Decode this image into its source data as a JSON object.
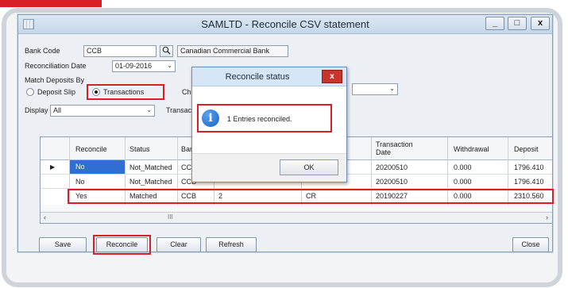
{
  "window": {
    "title": "SAMLTD - Reconcile CSV statement",
    "controls": [
      "_",
      "□",
      "x"
    ]
  },
  "form": {
    "bank_code_label": "Bank Code",
    "bank_code_value": "CCB",
    "bank_name_value": "Canadian Commercial Bank",
    "recon_date_label": "Reconciliation Date",
    "recon_date_value": "01-09-2016",
    "match_label": "Match Deposits By",
    "option_deposit_slip": "Deposit Slip",
    "option_transactions": "Transactions",
    "selected_option": "Transactions",
    "display_label": "Display",
    "display_value": "All",
    "check_label_partial": "Chec",
    "transaction_label_partial": "Transactio"
  },
  "grid": {
    "headers": [
      "Reconcile",
      "Status",
      "Bank",
      "",
      "",
      "Transaction Date",
      "Withdrawal",
      "Deposit"
    ],
    "rows": [
      {
        "reconcile": "No",
        "status": "Not_Matched",
        "bank": "CCB",
        "ref": "",
        "type": "",
        "date": "20200510",
        "withdrawal": "0.000",
        "deposit": "1796.410",
        "current": true
      },
      {
        "reconcile": "No",
        "status": "Not_Matched",
        "bank": "CCB",
        "ref": "",
        "type": "",
        "date": "20200510",
        "withdrawal": "0.000",
        "deposit": "1796.410",
        "current": false
      },
      {
        "reconcile": "Yes",
        "status": "Matched",
        "bank": "CCB",
        "ref": "2",
        "type": "CR",
        "date": "20190227",
        "withdrawal": "0.000",
        "deposit": "2310.560",
        "current": false
      }
    ],
    "scroll_grip": "III"
  },
  "buttons": {
    "save": "Save",
    "reconcile": "Reconcile",
    "clear": "Clear",
    "refresh": "Refresh",
    "close": "Close"
  },
  "dialog": {
    "title": "Reconcile status",
    "message": "1 Entries reconciled.",
    "ok": "OK",
    "close_glyph": "x",
    "info_glyph": "i"
  },
  "colors": {
    "highlight": "#d81f26",
    "title_gradient": "#c6d7ea",
    "selection": "#2f6fd3"
  }
}
